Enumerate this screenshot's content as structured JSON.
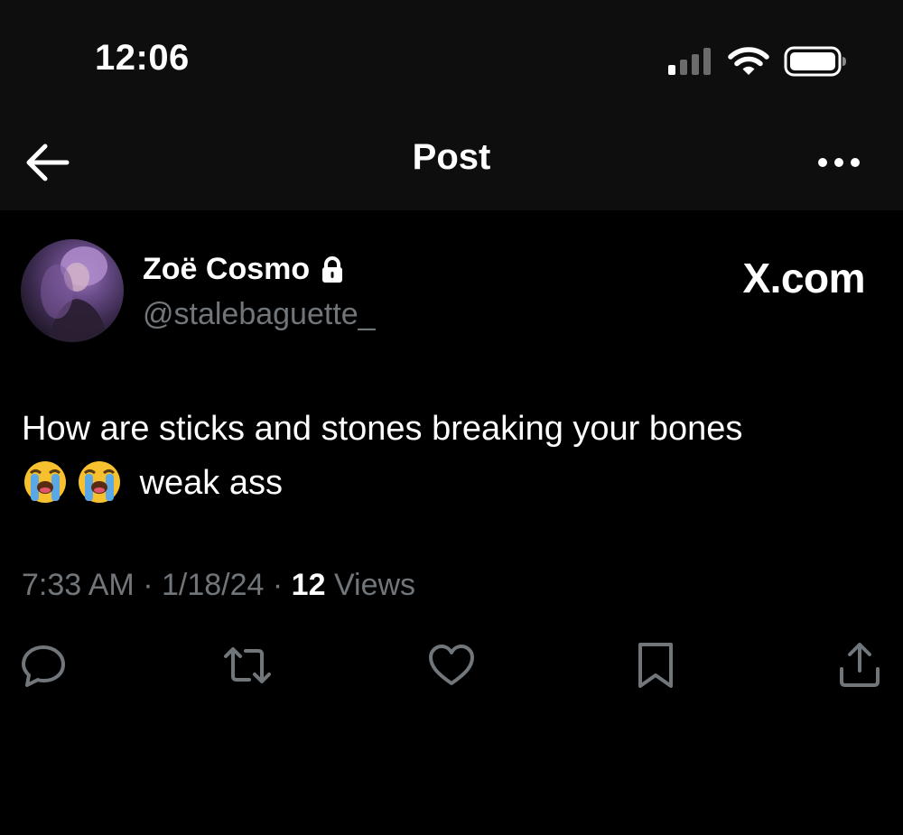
{
  "status_bar": {
    "time": "12:06",
    "icons": [
      "signal-icon",
      "wifi-icon",
      "battery-icon"
    ]
  },
  "nav": {
    "title": "Post",
    "back_icon": "arrow-left-icon",
    "more_icon": "more-horizontal-icon"
  },
  "post": {
    "author": {
      "display_name": "Zoë Cosmo",
      "handle": "@stalebaguette_",
      "protected_icon": "lock-icon"
    },
    "watermark": "X.com",
    "text_line1": "How are sticks and stones breaking your bones",
    "text_line2": "weak ass",
    "emojis": [
      "loudly-crying-face",
      "loudly-crying-face"
    ],
    "time": "7:33 AM",
    "date": "1/18/24",
    "views_count": "12",
    "views_label": "Views",
    "separator": "·"
  },
  "actions": [
    {
      "name": "reply",
      "icon": "reply-icon"
    },
    {
      "name": "repost",
      "icon": "repost-icon"
    },
    {
      "name": "like",
      "icon": "heart-icon"
    },
    {
      "name": "bookmark",
      "icon": "bookmark-icon"
    },
    {
      "name": "share",
      "icon": "share-icon"
    }
  ],
  "colors": {
    "background": "#000000",
    "header_background": "#0e0e0e",
    "primary_text": "#ffffff",
    "secondary_text": "#71767b",
    "icon_color": "#71767b"
  }
}
